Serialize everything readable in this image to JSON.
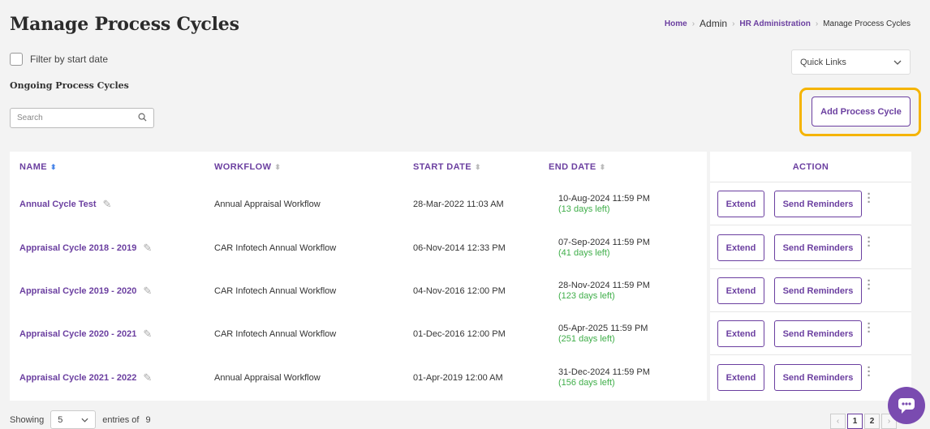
{
  "page": {
    "title": "Manage Process Cycles"
  },
  "breadcrumb": {
    "home": "Home",
    "admin": "Admin",
    "hr": "HR Administration",
    "current": "Manage Process Cycles"
  },
  "filter": {
    "label": "Filter by start date"
  },
  "section": {
    "label": "Ongoing Process Cycles"
  },
  "search": {
    "placeholder": "Search"
  },
  "quick_links": {
    "label": "Quick Links"
  },
  "add_button": {
    "label": "Add Process Cycle"
  },
  "table": {
    "columns": {
      "name": "NAME",
      "workflow": "WORKFLOW",
      "start": "START DATE",
      "end": "END DATE",
      "action": "ACTION"
    },
    "rows": [
      {
        "name": "Annual Cycle Test",
        "workflow": "Annual Appraisal Workflow",
        "start": "28-Mar-2022 11:03 AM",
        "end": "10-Aug-2024 11:59 PM",
        "days": "(13 days left)"
      },
      {
        "name": "Appraisal Cycle 2018 - 2019",
        "workflow": "CAR Infotech Annual Workflow",
        "start": "06-Nov-2014 12:33 PM",
        "end": "07-Sep-2024 11:59 PM",
        "days": "(41 days left)"
      },
      {
        "name": "Appraisal Cycle 2019 - 2020",
        "workflow": "CAR Infotech Annual Workflow",
        "start": "04-Nov-2016 12:00 PM",
        "end": "28-Nov-2024 11:59 PM",
        "days": "(123 days left)"
      },
      {
        "name": "Appraisal Cycle 2020 - 2021",
        "workflow": "CAR Infotech Annual Workflow",
        "start": "01-Dec-2016 12:00 PM",
        "end": "05-Apr-2025 11:59 PM",
        "days": "(251 days left)"
      },
      {
        "name": "Appraisal Cycle 2021 - 2022",
        "workflow": "Annual Appraisal Workflow",
        "start": "01-Apr-2019 12:00 AM",
        "end": "31-Dec-2024 11:59 PM",
        "days": "(156 days left)"
      }
    ],
    "actions": {
      "extend": "Extend",
      "remind": "Send Reminders"
    }
  },
  "footer": {
    "showing": "Showing",
    "page_size": "5",
    "entries_of": "entries of",
    "total": "9"
  },
  "pagination": {
    "prev": "‹",
    "pages": [
      "1",
      "2"
    ],
    "next": "›"
  },
  "colors": {
    "accent": "#6b3fa0",
    "days_left": "#3fae49",
    "highlight": "#f5b400"
  }
}
